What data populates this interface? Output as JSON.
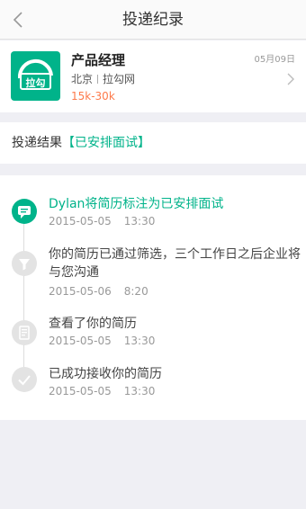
{
  "nav": {
    "title": "投递纪录",
    "back_icon": "chevron-left-icon"
  },
  "job": {
    "title": "产品经理",
    "city": "北京",
    "company": "拉勾网",
    "salary": "15k-30k",
    "date": "05月09日",
    "logo_text": "拉勾"
  },
  "result": {
    "label": "投递结果",
    "value": "【已安排面试】"
  },
  "timeline": [
    {
      "text": "Dylan将简历标注为已安排面试",
      "date": "2015-05-05",
      "time": "13:30",
      "icon": "chat-icon",
      "active": true
    },
    {
      "text": "你的简历已通过筛选，三个工作日之后企业将与您沟通",
      "date": "2015-05-06",
      "time": "8:20",
      "icon": "filter-icon",
      "active": false
    },
    {
      "text": "查看了你的简历",
      "date": "2015-05-05",
      "time": "13:30",
      "icon": "resume-icon",
      "active": false
    },
    {
      "text": "已成功接收你的简历",
      "date": "2015-05-05",
      "time": "13:30",
      "icon": "check-icon",
      "active": false
    }
  ],
  "colors": {
    "accent": "#00b38a",
    "salary": "#fd7a4b",
    "background": "#efeff4"
  }
}
